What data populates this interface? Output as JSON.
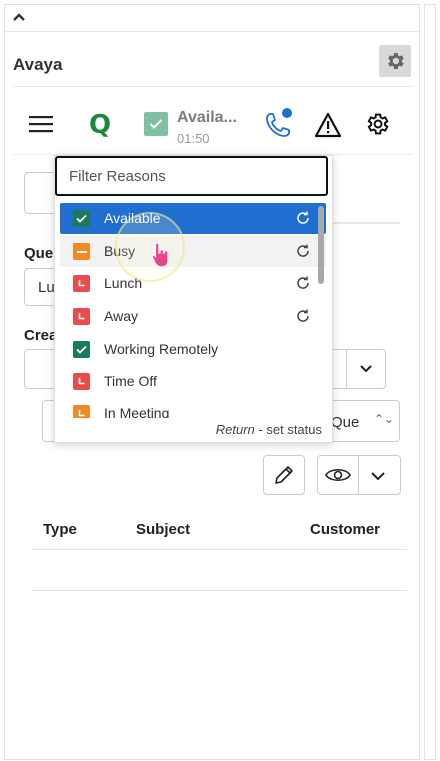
{
  "app": {
    "title": "Avaya"
  },
  "toolbar": {
    "status_name": "Availa...",
    "status_time": "01:50",
    "logo_letter": "Q"
  },
  "form": {
    "queue_label": "Que",
    "queue_value": "Lu",
    "create_label": "Crea",
    "select_value": "Que",
    "select_arrows": "⌃⌄"
  },
  "table": {
    "columns": [
      "Type",
      "Subject",
      "Customer"
    ]
  },
  "dropdown": {
    "filter_placeholder": "Filter Reasons",
    "reasons": [
      {
        "label": "Available",
        "color": "#1a7a5a",
        "icon": "check-icon",
        "cycle": true
      },
      {
        "label": "Busy",
        "color": "#f08a24",
        "icon": "dash-icon",
        "cycle": true
      },
      {
        "label": "Lunch",
        "color": "#e84c4c",
        "icon": "clock-icon",
        "cycle": true
      },
      {
        "label": "Away",
        "color": "#e84c4c",
        "icon": "clock-icon",
        "cycle": true
      },
      {
        "label": "Working Remotely",
        "color": "#1a7a5a",
        "icon": "check-icon",
        "cycle": false
      },
      {
        "label": "Time Off",
        "color": "#e84c4c",
        "icon": "clock-icon",
        "cycle": false
      },
      {
        "label": "In Meeting",
        "color": "#f08a24",
        "icon": "clock-icon",
        "cycle": false
      }
    ],
    "footer_key": "Return",
    "footer_text": "- set status"
  },
  "colors": {
    "accent": "#1f6fd1",
    "available": "#7fc0a4",
    "brand_green": "#1a8a3a"
  }
}
